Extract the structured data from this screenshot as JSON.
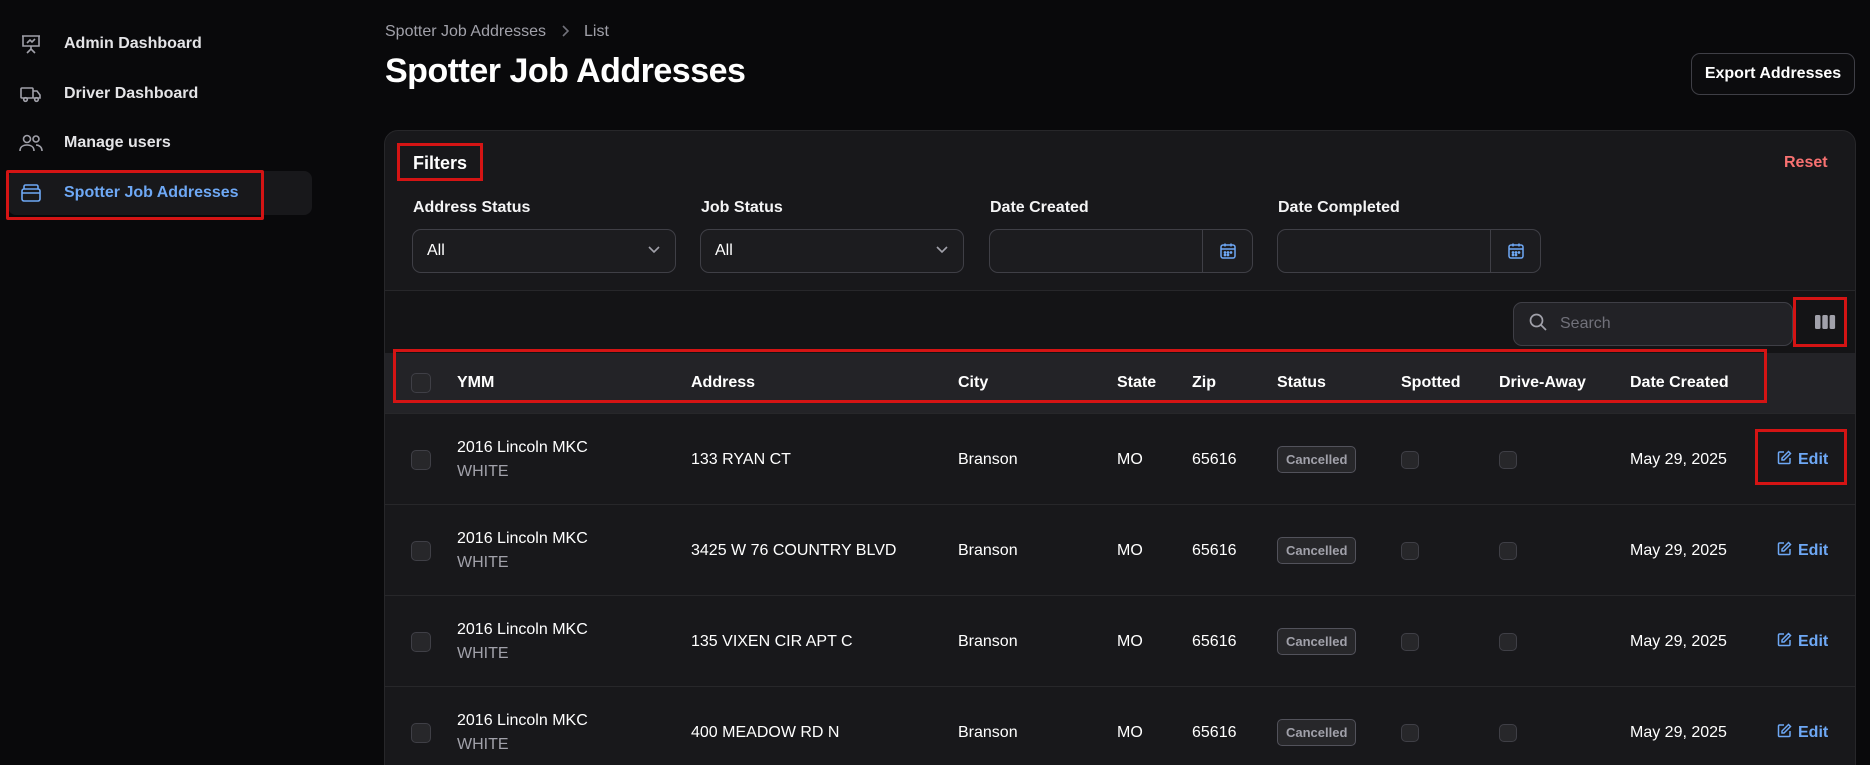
{
  "sidebar": {
    "items": [
      {
        "label": "Admin Dashboard",
        "icon": "presentation-chart-icon"
      },
      {
        "label": "Driver Dashboard",
        "icon": "truck-icon"
      },
      {
        "label": "Manage users",
        "icon": "users-icon"
      },
      {
        "label": "Spotter Job Addresses",
        "icon": "archive-box-icon",
        "active": true
      }
    ]
  },
  "header": {
    "breadcrumb": [
      "Spotter Job Addresses",
      "List"
    ],
    "title": "Spotter Job Addresses",
    "export_label": "Export Addresses"
  },
  "filters": {
    "title": "Filters",
    "reset_label": "Reset",
    "address_status": {
      "label": "Address Status",
      "value": "All"
    },
    "job_status": {
      "label": "Job Status",
      "value": "All"
    },
    "date_created": {
      "label": "Date Created",
      "value": ""
    },
    "date_completed": {
      "label": "Date Completed",
      "value": ""
    }
  },
  "search": {
    "placeholder": "Search",
    "value": ""
  },
  "table": {
    "columns": [
      "YMM",
      "Address",
      "City",
      "State",
      "Zip",
      "Status",
      "Spotted",
      "Drive-Away",
      "Date Created"
    ],
    "edit_label": "Edit",
    "rows": [
      {
        "ymm": "2016 Lincoln MKC",
        "color": "WHITE",
        "address": "133 RYAN CT",
        "city": "Branson",
        "state": "MO",
        "zip": "65616",
        "status": "Cancelled",
        "date_created": "May 29, 2025"
      },
      {
        "ymm": "2016 Lincoln MKC",
        "color": "WHITE",
        "address": "3425 W 76 COUNTRY BLVD",
        "city": "Branson",
        "state": "MO",
        "zip": "65616",
        "status": "Cancelled",
        "date_created": "May 29, 2025"
      },
      {
        "ymm": "2016 Lincoln MKC",
        "color": "WHITE",
        "address": "135 VIXEN CIR APT C",
        "city": "Branson",
        "state": "MO",
        "zip": "65616",
        "status": "Cancelled",
        "date_created": "May 29, 2025"
      },
      {
        "ymm": "2016 Lincoln MKC",
        "color": "WHITE",
        "address": "400 MEADOW RD N",
        "city": "Branson",
        "state": "MO",
        "zip": "65616",
        "status": "Cancelled",
        "date_created": "May 29, 2025"
      }
    ]
  },
  "colors": {
    "accent": "#6ea8f5",
    "danger": "#f87171",
    "highlight": "#d41414",
    "background": "#09090b"
  }
}
